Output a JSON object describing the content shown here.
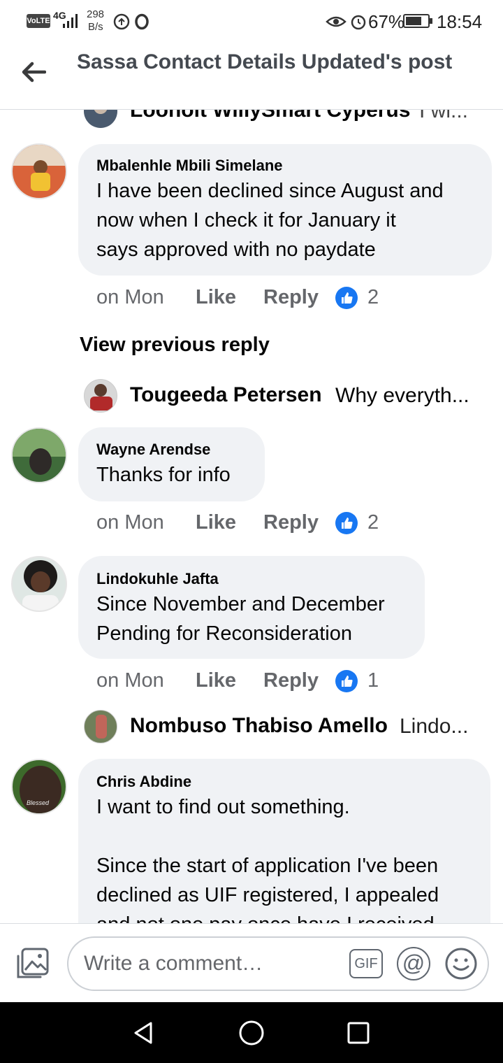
{
  "status_bar": {
    "volte": "VoLTE",
    "network": "4G",
    "speed_value": "298",
    "speed_unit": "B/s",
    "battery": "67%",
    "time": "18:54"
  },
  "header": {
    "title": "Sassa Contact Details Updated's post",
    "icons": [
      "back-arrow-icon"
    ]
  },
  "replies": [
    {
      "name": "Loonoit WillySmart Cyperus",
      "text": "I wi..."
    },
    {
      "name": "Tougeeda Petersen",
      "text": "Why everyth..."
    },
    {
      "name": "Nombuso Thabiso Amello",
      "text": "Lindo..."
    }
  ],
  "comments": [
    {
      "name": "Mbalenhle Mbili Simelane",
      "text": "I have been declined since August and\nnow when I check it for January it\nsays approved with no paydate",
      "time": "on Mon",
      "like": "Like",
      "reply": "Reply",
      "reactions": "2"
    },
    {
      "name": "Wayne Arendse",
      "text": "Thanks for info",
      "time": "on Mon",
      "like": "Like",
      "reply": "Reply",
      "reactions": "2"
    },
    {
      "name": "Lindokuhle Jafta",
      "text": "Since November and December\nPending for  Reconsideration",
      "time": "on Mon",
      "like": "Like",
      "reply": "Reply",
      "reactions": "1"
    },
    {
      "name": "Chris Abdine",
      "text": "I want to find out something.\n\nSince the start of application I've been\ndeclined as UIF registered, I appealed\nand not one pay once have I received"
    }
  ],
  "view_previous": "View previous reply",
  "composer": {
    "placeholder": "Write a comment…",
    "gif_label": "GIF",
    "at_label": "@"
  },
  "colors": {
    "like_blue": "#1877f2",
    "bubble_bg": "#f0f2f5",
    "secondary_text": "#65676b"
  }
}
